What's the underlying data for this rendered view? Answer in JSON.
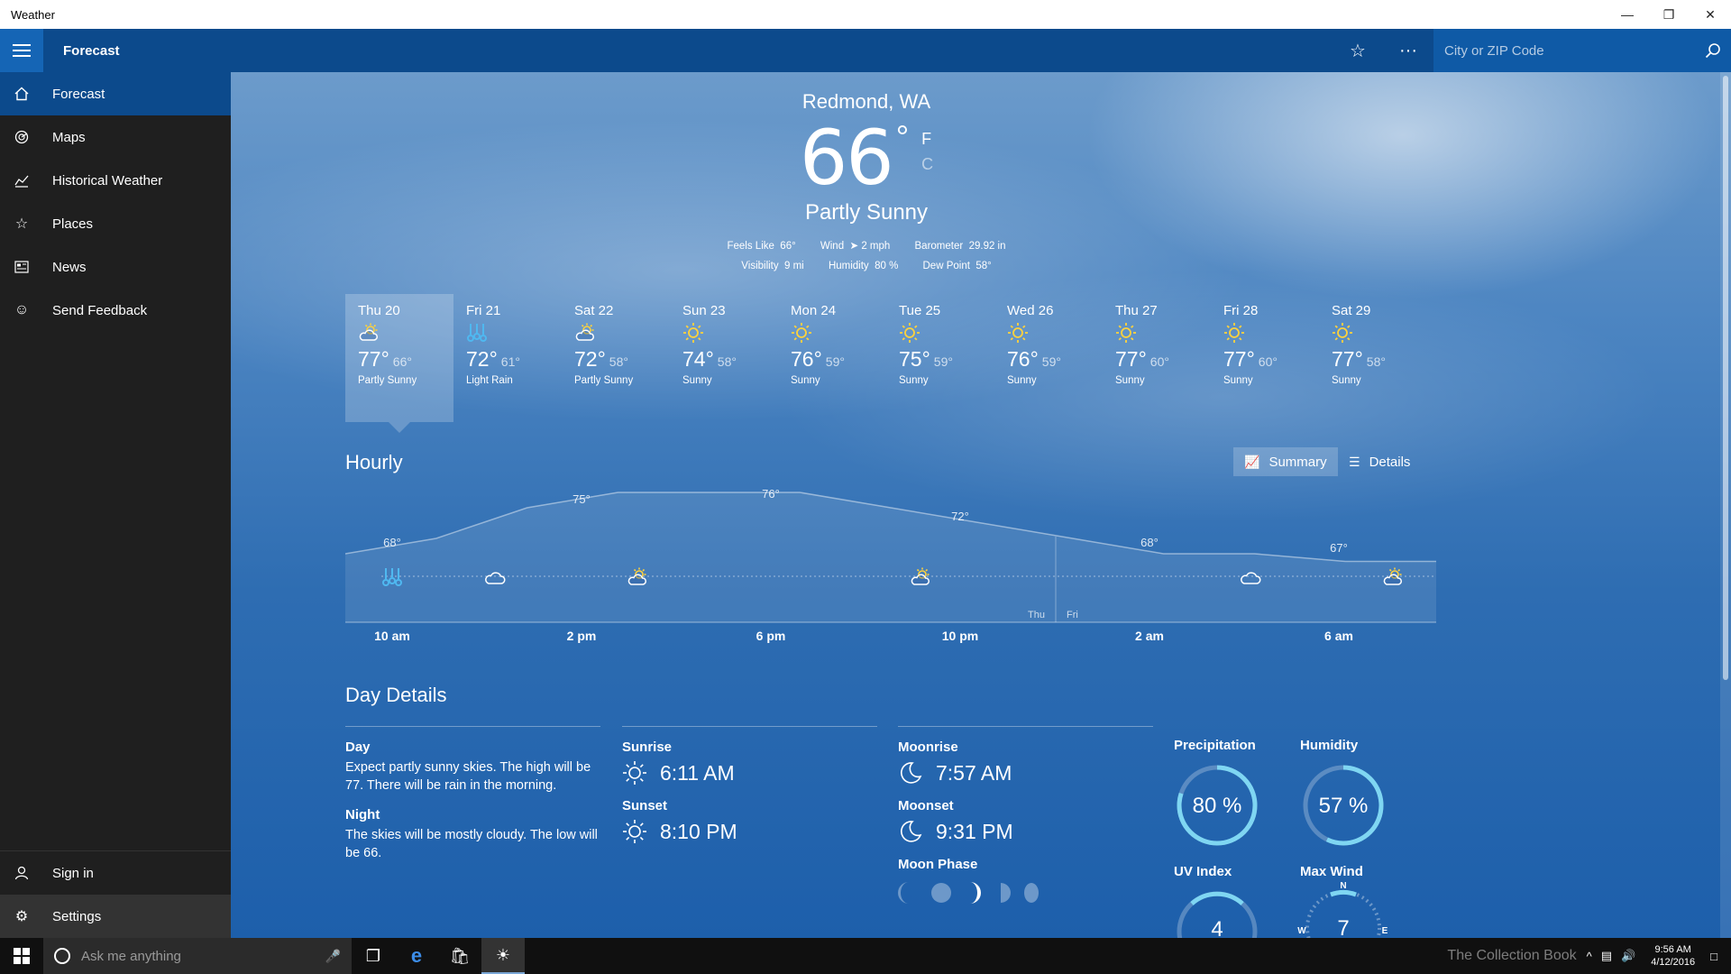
{
  "window": {
    "title": "Weather"
  },
  "appbar": {
    "page_title": "Forecast",
    "search_placeholder": "City or ZIP Code"
  },
  "sidebar": {
    "items": [
      {
        "label": "Forecast",
        "icon": "home-icon"
      },
      {
        "label": "Maps",
        "icon": "radar-icon"
      },
      {
        "label": "Historical Weather",
        "icon": "chart-icon"
      },
      {
        "label": "Places",
        "icon": "star-list-icon"
      },
      {
        "label": "News",
        "icon": "news-icon"
      },
      {
        "label": "Send Feedback",
        "icon": "smiley-icon"
      }
    ],
    "bottom": [
      {
        "label": "Sign in",
        "icon": "person-icon"
      },
      {
        "label": "Settings",
        "icon": "gear-icon"
      }
    ]
  },
  "current": {
    "location": "Redmond, WA",
    "temp": "66",
    "degree": "°",
    "unit_f": "F",
    "unit_c": "C",
    "condition": "Partly Sunny",
    "feels_like_label": "Feels Like",
    "feels_like": "66°",
    "wind_label": "Wind",
    "wind": "2 mph",
    "barometer_label": "Barometer",
    "barometer": "29.92 in",
    "visibility_label": "Visibility",
    "visibility": "9 mi",
    "humidity_label": "Humidity",
    "humidity": "80 %",
    "dew_point_label": "Dew Point",
    "dew_point": "58°"
  },
  "daily": [
    {
      "day": "Thu 20",
      "high": "77°",
      "low": "66°",
      "cond": "Partly Sunny",
      "icon": "partly-sunny"
    },
    {
      "day": "Fri 21",
      "high": "72°",
      "low": "61°",
      "cond": "Light Rain",
      "icon": "rain"
    },
    {
      "day": "Sat 22",
      "high": "72°",
      "low": "58°",
      "cond": "Partly Sunny",
      "icon": "partly-sunny"
    },
    {
      "day": "Sun 23",
      "high": "74°",
      "low": "58°",
      "cond": "Sunny",
      "icon": "sunny"
    },
    {
      "day": "Mon 24",
      "high": "76°",
      "low": "59°",
      "cond": "Sunny",
      "icon": "sunny"
    },
    {
      "day": "Tue 25",
      "high": "75°",
      "low": "59°",
      "cond": "Sunny",
      "icon": "sunny"
    },
    {
      "day": "Wed 26",
      "high": "76°",
      "low": "59°",
      "cond": "Sunny",
      "icon": "sunny"
    },
    {
      "day": "Thu 27",
      "high": "77°",
      "low": "60°",
      "cond": "Sunny",
      "icon": "sunny"
    },
    {
      "day": "Fri 28",
      "high": "77°",
      "low": "60°",
      "cond": "Sunny",
      "icon": "sunny"
    },
    {
      "day": "Sat 29",
      "high": "77°",
      "low": "58°",
      "cond": "Sunny",
      "icon": "sunny"
    }
  ],
  "hourly": {
    "title": "Hourly",
    "summary_label": "Summary",
    "details_label": "Details",
    "hour_labels": [
      "10 am",
      "2 pm",
      "6 pm",
      "10 pm",
      "2 am",
      "6 am"
    ],
    "temp_labels": [
      "68°",
      "75°",
      "76°",
      "72°",
      "68°",
      "67°"
    ],
    "day_divider": [
      "Thu",
      "Fri"
    ],
    "icons": [
      "rain",
      "cloudy",
      "partly-sunny",
      "partly-sunny",
      "cloudy",
      "partly-sunny"
    ]
  },
  "day_details": {
    "title": "Day Details",
    "day_label": "Day",
    "day_text": "Expect partly sunny skies. The high will be 77. There will be rain in the morning.",
    "night_label": "Night",
    "night_text": "The skies will be mostly cloudy. The low will be 66.",
    "sunrise_label": "Sunrise",
    "sunrise": "6:11 AM",
    "sunset_label": "Sunset",
    "sunset": "8:10 PM",
    "moonrise_label": "Moonrise",
    "moonrise": "7:57 AM",
    "moonset_label": "Moonset",
    "moonset": "9:31 PM",
    "moon_phase_label": "Moon Phase",
    "precip_label": "Precipitation",
    "precip": "80 %",
    "precip_value": 0.8,
    "humidity_label": "Humidity",
    "humidity": "57 %",
    "humidity_value": 0.57,
    "uv_label": "UV Index",
    "uv": "4",
    "wind_label": "Max Wind",
    "wind": "7",
    "compass": {
      "n": "N",
      "w": "W",
      "e": "E"
    }
  },
  "taskbar": {
    "search_placeholder": "Ask me anything",
    "watermark": "The Collection Book",
    "time": "9:56 AM",
    "date": "4/12/2016"
  },
  "colors": {
    "accent": "#0c4a8c",
    "sidebar": "#1f1f1f",
    "gauge": "#7fd6f2",
    "sun": "#ffd23c",
    "rain": "#4fb8f0"
  }
}
